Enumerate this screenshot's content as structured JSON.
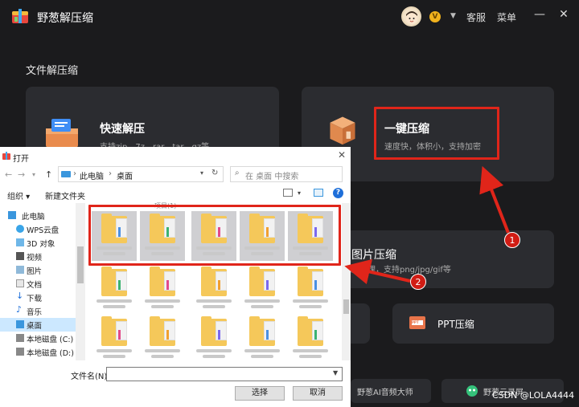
{
  "app": {
    "title": "野葱解压缩",
    "vip": "V",
    "top_links": [
      "客服",
      "菜单"
    ],
    "window_buttons": [
      "—",
      "✕"
    ]
  },
  "section_title": "文件解压缩",
  "cards": {
    "quick_extract": {
      "title": "快速解压",
      "desc": "支持zip、7z、rar、tar、gz等"
    },
    "one_click": {
      "title": "一键压缩",
      "desc": "速度快，体积小，支持加密"
    },
    "image_compress": {
      "title": "图片压缩",
      "desc": "批量处理，支持png/jpg/gif等"
    },
    "ppt_compress": {
      "title": "PPT压缩",
      "icon_text": "PPT"
    },
    "audio": {
      "title": "野葱AI音频大师"
    },
    "cloud": {
      "title": "野葱云录屏"
    }
  },
  "annotations": [
    "1",
    "2"
  ],
  "dialog": {
    "title": "打开",
    "breadcrumb": [
      "此电脑",
      "桌面"
    ],
    "search_placeholder": "在 桌面 中搜索",
    "toolbar": {
      "organize": "组织 ▾",
      "new_folder": "新建文件夹"
    },
    "column_header": "项目(1)",
    "tree": [
      "此电脑",
      "WPS云盘",
      "3D 对象",
      "视频",
      "图片",
      "文档",
      "下载",
      "音乐",
      "桌面",
      "本地磁盘 (C:)",
      "本地磁盘 (D:)"
    ],
    "filename_label": "文件名(N):",
    "buttons": {
      "select": "选择",
      "cancel": "取消"
    }
  },
  "watermark": "CSDN @LOLA4444",
  "colors": {
    "accent_red": "#e0251a",
    "dark_bg": "#1b1b1d",
    "card_bg": "#2b2c30",
    "selection": "#cce8ff"
  }
}
